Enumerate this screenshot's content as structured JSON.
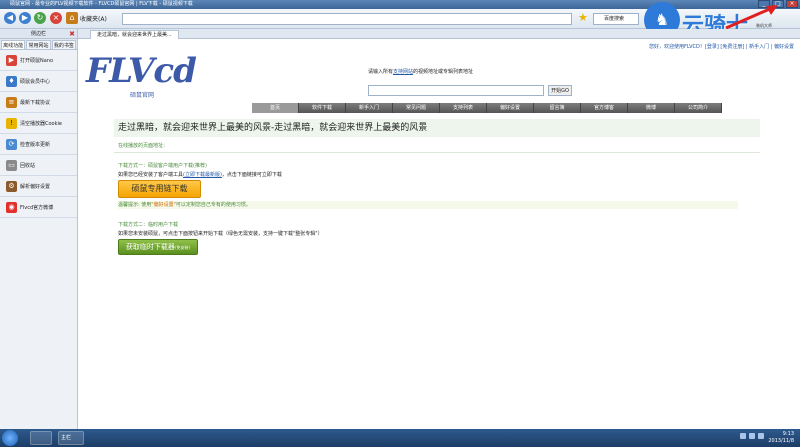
{
  "window": {
    "title": "硕鼠官网 - 最专业的FLV视频下载软件 - FLVCD硕鼠官网 | FLV下载 - 硕鼠视频下载",
    "buttons": [
      "_",
      "□",
      "×"
    ]
  },
  "toolbar": {
    "favorites_label": "收藏夹(A)",
    "search_engine": "百度搜索"
  },
  "watermark": {
    "brand": "云骑士",
    "sub": "装机大师"
  },
  "sidebar": {
    "header": "侧边栏",
    "tabs": [
      "离线功能",
      "常用网站",
      "我的书签"
    ],
    "items": [
      {
        "label": "打开硕鼠Nano",
        "icon": "nano-icon",
        "color": "#d9443a"
      },
      {
        "label": "硕鼠会员中心",
        "icon": "vip-icon",
        "color": "#3a79c9"
      },
      {
        "label": "最新下载协议",
        "icon": "doc-icon",
        "color": "#c77c1a"
      },
      {
        "label": "清空播放器Cookie",
        "icon": "warning-icon",
        "color": "#e8b400"
      },
      {
        "label": "检查版本更新",
        "icon": "update-icon",
        "color": "#4a8ad0"
      },
      {
        "label": "回收站",
        "icon": "folder-icon",
        "color": "#8a8a8a"
      },
      {
        "label": "解析偏好设置",
        "icon": "settings-icon",
        "color": "#8a5b2b"
      },
      {
        "label": "Flvcd官方微博",
        "icon": "weibo-icon",
        "color": "#e2302a"
      }
    ]
  },
  "tabs": {
    "active": "走过黑暗，就会迎来世界上最美..."
  },
  "content": {
    "top_links": "您好，欢迎使用FLVCD！[登录] [免费注册] | 新手入门 | 偏好设置",
    "logo_text": "FLVcd",
    "logo_cn": "硕鼠官网",
    "prompt_prefix": "请输入所有",
    "prompt_link": "支持网站",
    "prompt_suffix": "的视频地址或专辑列表地址",
    "start_button": "开始GO",
    "nav": [
      "首页",
      "软件下载",
      "新手入门",
      "常见问题",
      "支持列表",
      "偏好设置",
      "留言簿",
      "官方博客",
      "微博",
      "公司简介"
    ],
    "banner": "走过黑暗，就会迎来世界上最美的风景-走过黑暗，就会迎来世界上最美的风景",
    "online_label": "在线播放的页面地址：",
    "method1_title": "下载方式一：硕鼠客户端用户下载(推荐)",
    "method1_desc_prefix": "如果您已经安装了客户端工具",
    "method1_desc_link": "(立即下载最新版)",
    "method1_desc_suffix": "，点击下面链接可立即下载",
    "orange_button": "硕鼠专用链下载",
    "tip_prefix": "温馨提示: 使用",
    "tip_link": "\"偏好设置\"",
    "tip_suffix": "可以定制您自己专有的使用习惯。",
    "method2_title": "下载方式二：临时用户下载",
    "method2_desc": "如果您未安装硕鼠，可点击下面按钮来开始下载（绿色无需安装，支持一键下载\"整张专辑\"）",
    "green_button": "获取临时下载器",
    "green_button_sub": "(免安装)"
  },
  "taskbar": {
    "app_label": "主栏",
    "time": "9:13",
    "date": "2013/11/8"
  },
  "colors": {
    "accent": "#3d5aa8",
    "orange": "#f5a300",
    "green": "#5a8f1f"
  }
}
